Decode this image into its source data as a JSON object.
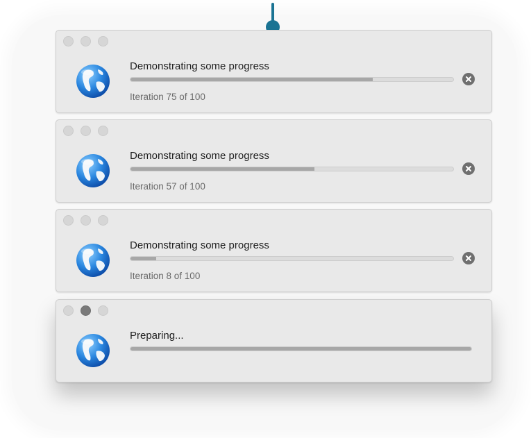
{
  "windows": [
    {
      "title": "Demonstrating some progress",
      "status": "Iteration 75 of 100",
      "progress": 0.75,
      "has_cancel": true,
      "active_light": null
    },
    {
      "title": "Demonstrating some progress",
      "status": "Iteration 57 of 100",
      "progress": 0.57,
      "has_cancel": true,
      "active_light": null
    },
    {
      "title": "Demonstrating some progress",
      "status": "Iteration 8 of 100",
      "progress": 0.08,
      "has_cancel": true,
      "active_light": null
    },
    {
      "title": "Preparing...",
      "status": "",
      "progress": 1.0,
      "has_cancel": false,
      "active_light": "minimize"
    }
  ],
  "icons": {
    "app": "globe-icon",
    "cancel": "close-circle-icon",
    "pointer": "pointer-pin-icon"
  },
  "colors": {
    "accent": "#1a7393",
    "window_bg": "#e9e9e9",
    "progress_fill": "#a7a7a7",
    "progress_track": "#dcdcdc",
    "cancel_button": "#6f6f6f"
  }
}
